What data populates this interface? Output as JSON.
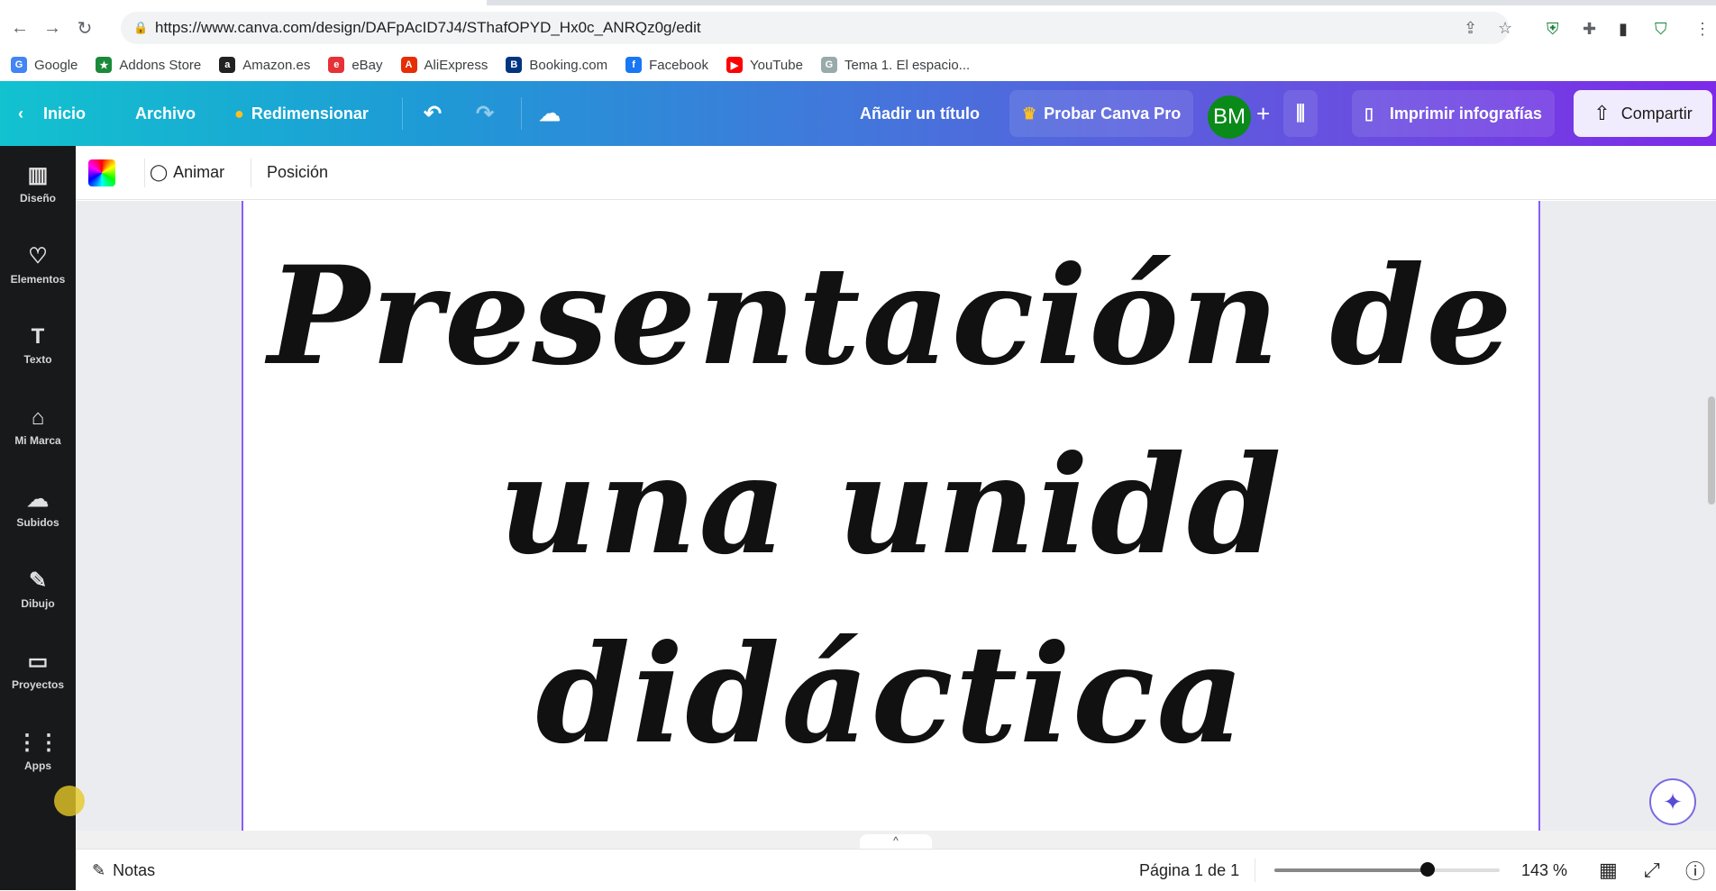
{
  "browser": {
    "url": "https://www.canva.com/design/DAFpAcID7J4/SThafOPYD_Hx0c_ANRQz0g/edit",
    "bookmarks": [
      {
        "label": "Google",
        "color": "#4285f4",
        "glyph": "G"
      },
      {
        "label": "Addons Store",
        "color": "#1a8a3a",
        "glyph": "★"
      },
      {
        "label": "Amazon.es",
        "color": "#222",
        "glyph": "a"
      },
      {
        "label": "eBay",
        "color": "#e53238",
        "glyph": "e"
      },
      {
        "label": "AliExpress",
        "color": "#e62e04",
        "glyph": "A"
      },
      {
        "label": "Booking.com",
        "color": "#003580",
        "glyph": "B"
      },
      {
        "label": "Facebook",
        "color": "#1877f2",
        "glyph": "f"
      },
      {
        "label": "YouTube",
        "color": "#ff0000",
        "glyph": "▶"
      },
      {
        "label": "Tema 1. El espacio...",
        "color": "#9aa",
        "glyph": "G"
      }
    ]
  },
  "header": {
    "home": "Inicio",
    "file": "Archivo",
    "resize": "Redimensionar",
    "add_title": "Añadir un título",
    "try_pro": "Probar Canva Pro",
    "avatar": "BM",
    "print": "Imprimir infografías",
    "share": "Compartir"
  },
  "toolbar": {
    "animate": "Animar",
    "position": "Posición"
  },
  "sidebar": [
    {
      "label": "Diseño",
      "icon": "▥"
    },
    {
      "label": "Elementos",
      "icon": "♡"
    },
    {
      "label": "Texto",
      "icon": "T"
    },
    {
      "label": "Mi Marca",
      "icon": "⌂"
    },
    {
      "label": "Subidos",
      "icon": "☁"
    },
    {
      "label": "Dibujo",
      "icon": "✎"
    },
    {
      "label": "Proyectos",
      "icon": "▭"
    },
    {
      "label": "Apps",
      "icon": "⋮⋮"
    }
  ],
  "canvas": {
    "lines": [
      "Presentación de",
      "una unidd",
      "didáctica"
    ]
  },
  "footer": {
    "notes": "Notas",
    "page": "Página 1 de 1",
    "zoom": "143 %",
    "zoom_fraction": 0.68
  }
}
